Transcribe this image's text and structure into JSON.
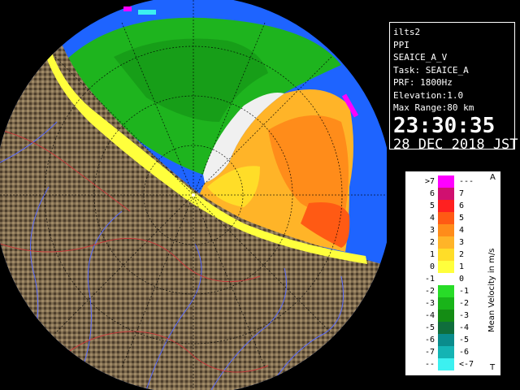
{
  "info_panel": {
    "site": "ilts2",
    "mode": "PPI",
    "product": "SEAICE_A_V",
    "task": "Task: SEAICE_A",
    "prf": "PRF: 1800Hz",
    "elevation": "Elevation:1.0",
    "max_range": "Max Range:80 km",
    "time": "23:30:35",
    "date": "28 DEC 2018 JST"
  },
  "legend": {
    "title": "Mean Velocity in m/s",
    "top_marker": "A",
    "bottom_marker": "T",
    "rows": [
      {
        "left": ">7",
        "right": "---",
        "color": "#ff00ff"
      },
      {
        "left": "6",
        "right": "7",
        "color": "#d01070"
      },
      {
        "left": "5",
        "right": "6",
        "color": "#ff2020"
      },
      {
        "left": "4",
        "right": "5",
        "color": "#ff5a14"
      },
      {
        "left": "3",
        "right": "4",
        "color": "#ff8c1a"
      },
      {
        "left": "2",
        "right": "3",
        "color": "#ffb428"
      },
      {
        "left": "1",
        "right": "2",
        "color": "#ffdd28"
      },
      {
        "left": "0",
        "right": "1",
        "color": "#ffff3c"
      },
      {
        "left": "-1",
        "right": "0",
        "color": "#ffffff"
      },
      {
        "left": "-2",
        "right": "-1",
        "color": "#28dc28"
      },
      {
        "left": "-3",
        "right": "-2",
        "color": "#19b419"
      },
      {
        "left": "-4",
        "right": "-3",
        "color": "#148c14"
      },
      {
        "left": "-5",
        "right": "-4",
        "color": "#0f6e3c"
      },
      {
        "left": "-6",
        "right": "-5",
        "color": "#0a8c8c"
      },
      {
        "left": "-7",
        "right": "-6",
        "color": "#14b4b4"
      },
      {
        "left": "---",
        "right": "<-7",
        "color": "#3cf0f0"
      }
    ]
  },
  "colors": {
    "background": "#000000",
    "no_echo_blue": "#1e64ff",
    "land": "#8a7454",
    "rivers": "#5a6cff",
    "boundaries": "#c83c3c"
  }
}
